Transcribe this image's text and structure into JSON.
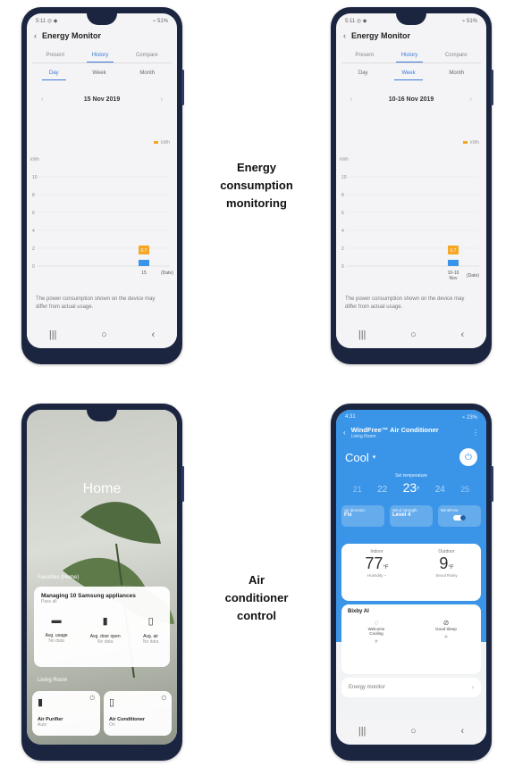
{
  "captions": {
    "energy": [
      "Energy",
      "consumption",
      "monitoring"
    ],
    "ac": [
      "Air",
      "conditioner",
      "control"
    ]
  },
  "energy_day": {
    "title": "Energy Monitor",
    "tabs": [
      "Present",
      "History",
      "Compare"
    ],
    "active_tab": 1,
    "periods": [
      "Day",
      "Week",
      "Month"
    ],
    "active_period": 0,
    "date": "15 Nov 2019",
    "legend": "kWh",
    "y_unit": "kWh",
    "y_ticks": [
      "10",
      "8",
      "6",
      "4",
      "2",
      "0"
    ],
    "x_label": "15",
    "x_suffix": "(Date)",
    "bar_label": "0.7",
    "value": 0.7,
    "note": "The power consumption shown on the device may differ from actual usage."
  },
  "energy_week": {
    "title": "Energy Monitor",
    "tabs": [
      "Present",
      "History",
      "Compare"
    ],
    "active_tab": 1,
    "periods": [
      "Day",
      "Week",
      "Month"
    ],
    "active_period": 1,
    "date": "10-16 Nov 2019",
    "legend": "kWh",
    "y_unit": "kWh",
    "y_ticks": [
      "10",
      "8",
      "6",
      "4",
      "2",
      "0"
    ],
    "x_label": "10-16",
    "x_label2": "Nov",
    "x_suffix": "(Date)",
    "bar_label": "0.7",
    "value": 0.7,
    "note": "The power consumption shown on the device may differ from actual usage."
  },
  "home": {
    "title": "Home",
    "section": "Favorites (Home)",
    "manage_title": "Managing 10 Samsung appliances",
    "manage_sub": "Pass all",
    "stats": [
      {
        "label": "Avg. usage",
        "value": "No data"
      },
      {
        "label": "Avg. door open",
        "value": "No data"
      },
      {
        "label": "Avg. air",
        "value": "No data"
      }
    ],
    "room": "Living Room",
    "devices": [
      {
        "name": "Air Purifier",
        "state": "Auto"
      },
      {
        "name": "Air Conditioner",
        "state": "On"
      }
    ]
  },
  "ac": {
    "title": "WindFree™ Air Conditioner",
    "subtitle": "Living Room",
    "mode": "Cool",
    "set_temp_label": "Set temperature",
    "temps": [
      "21",
      "22",
      "23",
      "24",
      "25"
    ],
    "active_temp": "23",
    "temp_unit": "°",
    "options": [
      {
        "label": "Air direction",
        "value": "Fix"
      },
      {
        "label": "Wind strength",
        "value": "Level 4"
      },
      {
        "label": "WindFree",
        "value": ""
      }
    ],
    "indoor_label": "Indoor",
    "indoor_temp": "77",
    "indoor_unit": "°F",
    "indoor_sub": "Humidity –",
    "outdoor_label": "Outdoor",
    "outdoor_temp": "9",
    "outdoor_unit": "°F",
    "outdoor_sub": "Seoul Rainy",
    "bixby_title": "Bixby AI",
    "bixby_items": [
      {
        "label": "Welcome Cooling"
      },
      {
        "label": "Good Sleep"
      }
    ],
    "energy_monitor": "Energy monitor",
    "accent": "#3a95e8"
  }
}
